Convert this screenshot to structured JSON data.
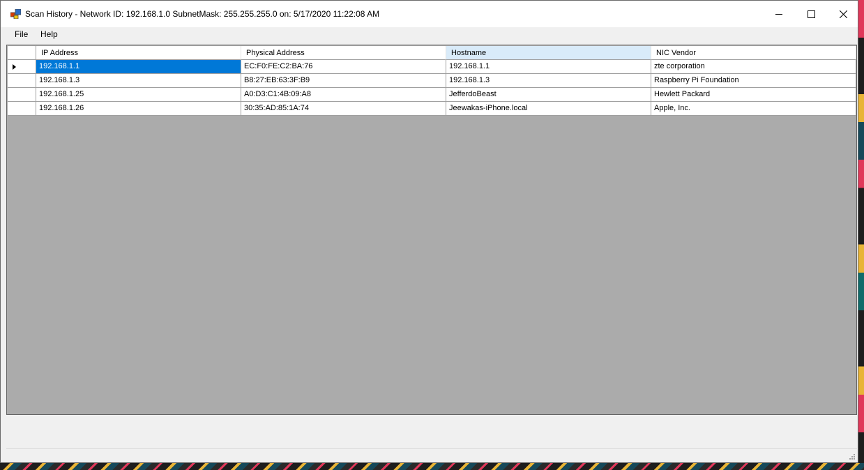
{
  "window": {
    "title": "Scan History - Network ID: 192.168.1.0 SubnetMask: 255.255.255.0 on: 5/17/2020 11:22:08 AM",
    "controls": [
      "minimize-icon",
      "maximize-icon",
      "close-icon"
    ]
  },
  "menu": {
    "file": "File",
    "help": "Help"
  },
  "grid": {
    "columns": [
      "IP Address",
      "Physical Address",
      "Hostname",
      "NIC Vendor"
    ],
    "sorted_column": "Hostname",
    "current_row_indicator": "triangle-right-icon",
    "rows": [
      {
        "ip": "192.168.1.1",
        "mac": "EC:F0:FE:C2:BA:76",
        "host": "192.168.1.1",
        "vendor": "zte corporation"
      },
      {
        "ip": "192.168.1.3",
        "mac": "B8:27:EB:63:3F:B9",
        "host": "192.168.1.3",
        "vendor": "Raspberry Pi Foundation"
      },
      {
        "ip": "192.168.1.25",
        "mac": "A0:D3:C1:4B:09:A8",
        "host": "JefferdoBeast",
        "vendor": "Hewlett Packard"
      },
      {
        "ip": "192.168.1.26",
        "mac": "30:35:AD:85:1A:74",
        "host": "Jeewakas-iPhone.local",
        "vendor": "Apple, Inc."
      }
    ]
  },
  "colors": {
    "selection": "#0078d7",
    "sorted_header": "#d9ebf9",
    "grid_background": "#ababab"
  }
}
